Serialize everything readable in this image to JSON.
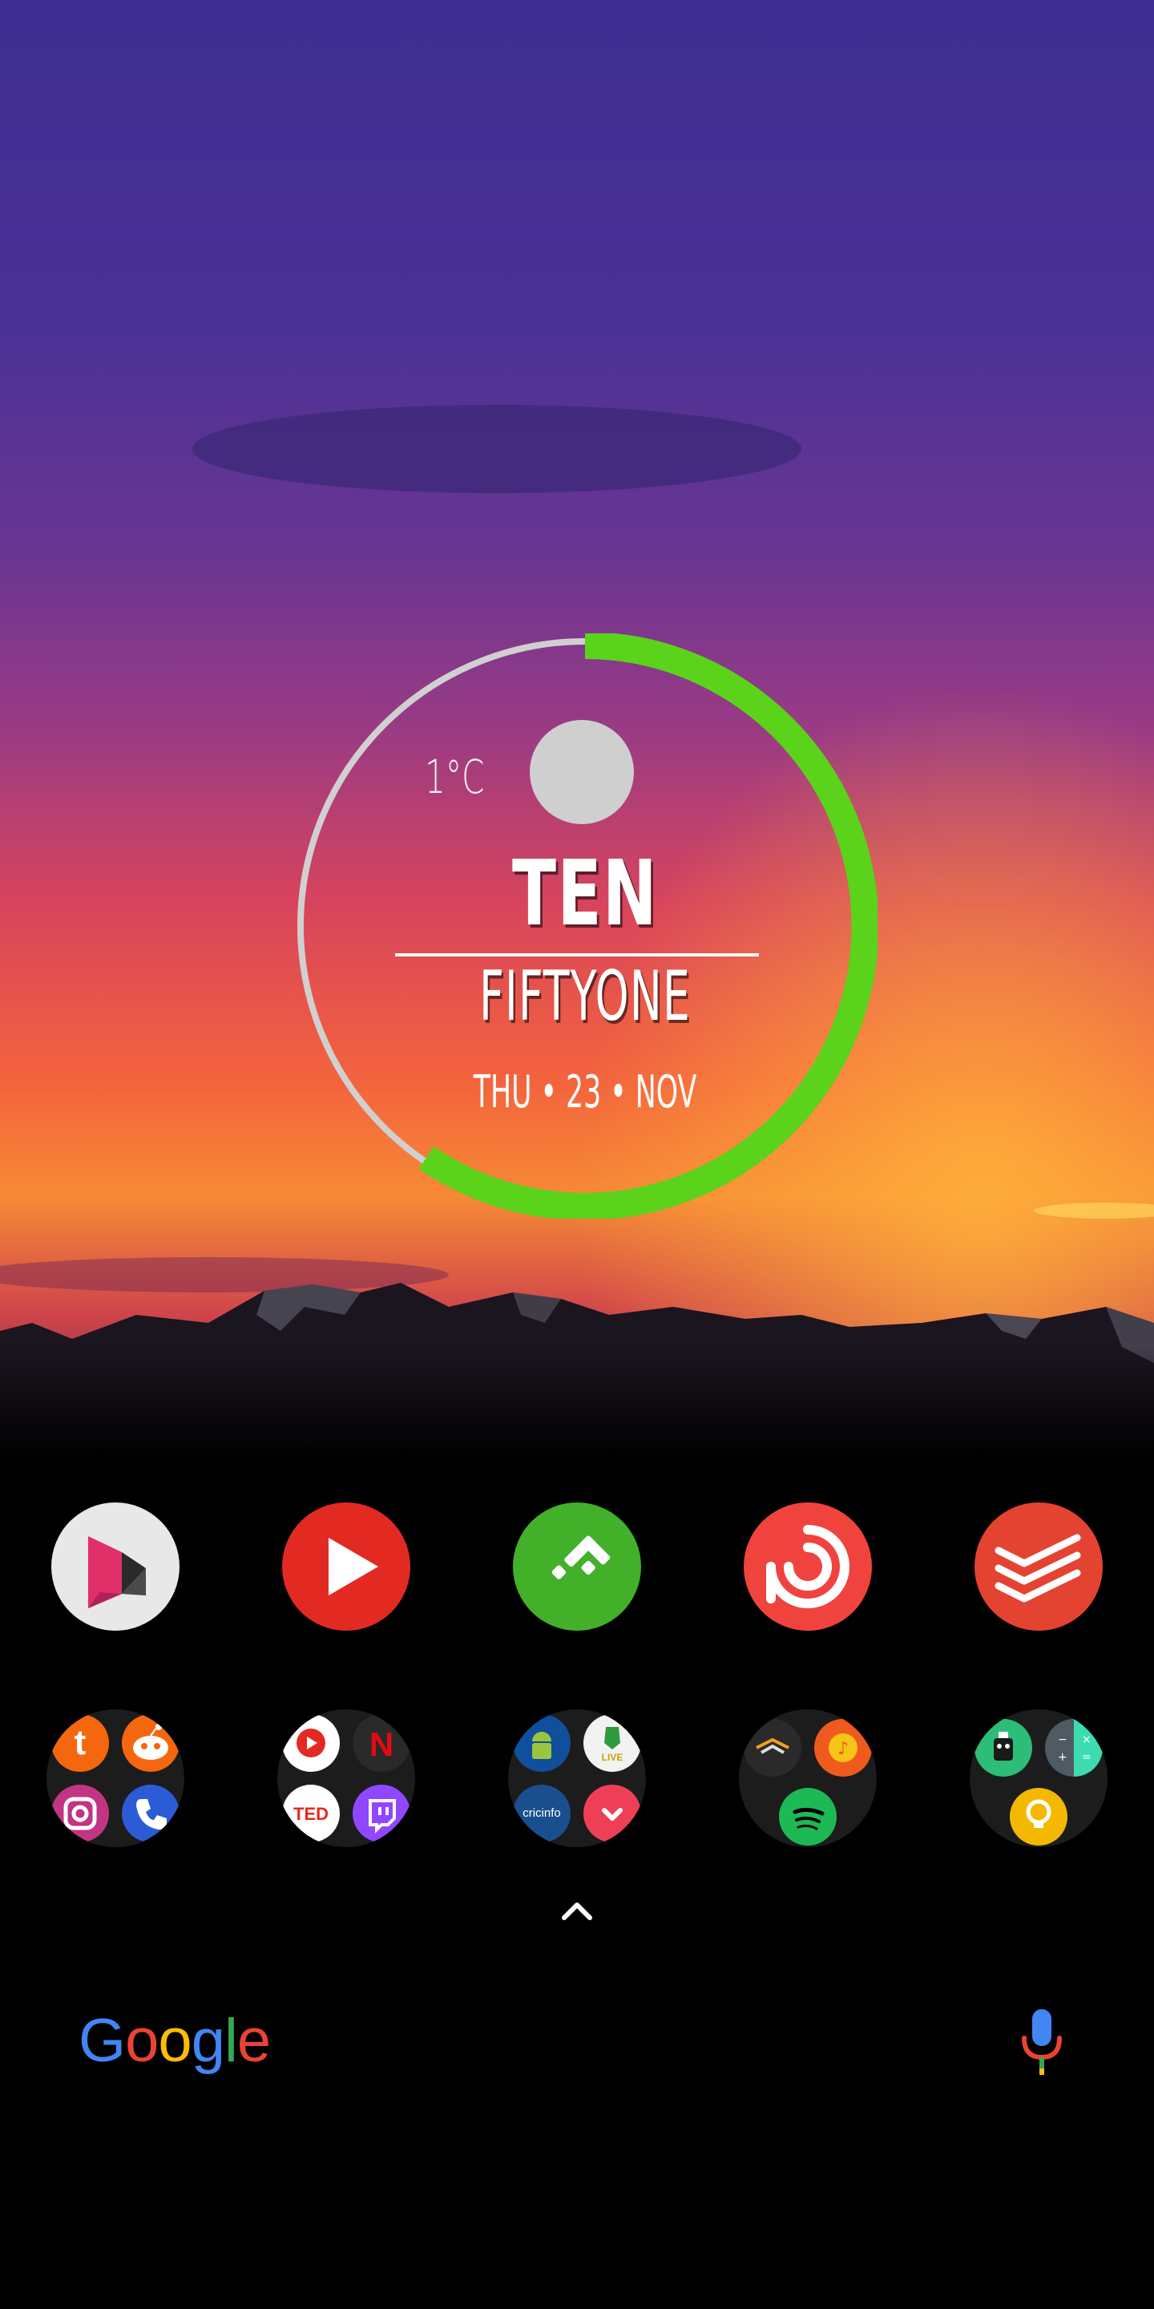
{
  "widget": {
    "temperature": "1°C",
    "hour": "TEN",
    "minute": "FIFTYONE",
    "date": "THU • 23 • NOV",
    "ring_color": "#5ad31a",
    "track_color": "#d0d0d0",
    "weather_icon": "moon-icon"
  },
  "dock": {
    "apps": [
      {
        "name": "graphics-app-icon",
        "color": "#e8e8e8"
      },
      {
        "name": "youtube-icon",
        "color": "#e22a23"
      },
      {
        "name": "feedly-icon",
        "color": "#43b02a"
      },
      {
        "name": "pocket-casts-icon",
        "color": "#f0433e"
      },
      {
        "name": "todoist-icon",
        "color": "#e44332"
      }
    ],
    "folders": [
      {
        "name": "social-folder",
        "apps": [
          "tumblr-icon",
          "reddit-icon",
          "instagram-icon",
          "phone-icon"
        ]
      },
      {
        "name": "video-folder",
        "apps": [
          "youtube-music-icon",
          "netflix-icon",
          "ted-icon",
          "twitch-icon"
        ]
      },
      {
        "name": "news-folder",
        "apps": [
          "android-icon",
          "cricket-live-icon",
          "espncricinfo-icon",
          "pocket-icon"
        ]
      },
      {
        "name": "music-folder",
        "apps": [
          "audible-icon",
          "music-player-icon",
          "spotify-icon"
        ]
      },
      {
        "name": "tools-folder",
        "apps": [
          "robot-app-icon",
          "calculator-icon",
          "keep-icon"
        ]
      }
    ],
    "folder_labels": {
      "ted": "TED",
      "live": "LIVE",
      "cricinfo": "cricinfo"
    }
  },
  "search": {
    "logo_letters": [
      {
        "char": "G",
        "color": "#4285F4"
      },
      {
        "char": "o",
        "color": "#EA4335"
      },
      {
        "char": "o",
        "color": "#FBBC05"
      },
      {
        "char": "g",
        "color": "#4285F4"
      },
      {
        "char": "l",
        "color": "#34A853"
      },
      {
        "char": "e",
        "color": "#EA4335"
      }
    ],
    "mic_icon": "microphone-icon"
  },
  "navigation": {
    "drawer_icon": "chevron-up-icon"
  }
}
